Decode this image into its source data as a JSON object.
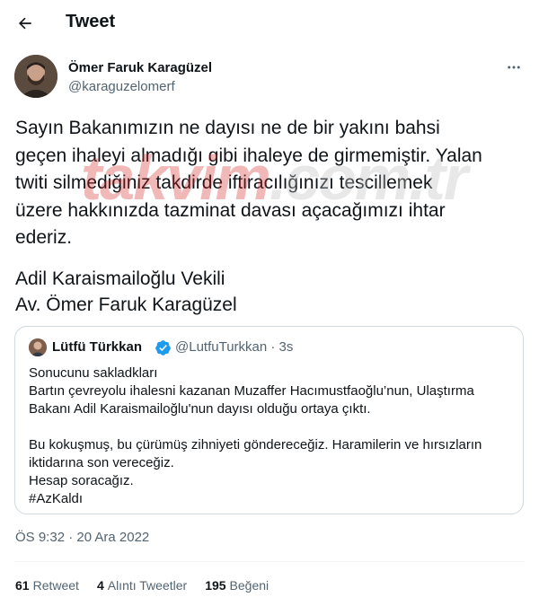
{
  "header": {
    "title": "Tweet"
  },
  "author": {
    "name": "Ömer Faruk Karagüzel",
    "handle": "@karaguzelomerf"
  },
  "tweet": {
    "text": "Sayın Bakanımızın ne dayısı ne de bir yakını bahsi\ngeçen ihaleyi almadığı gibi ihaleye de girmemiştir. Yalan\ntwiti silmediğiniz takdirde iftiracılığınızı tescillemek\nüzere hakkınızda tazminat davası açacağımızı ihtar\nederiz.",
    "signature_line1": "Adil Karaismailoğlu Vekili",
    "signature_line2": "Av. Ömer Faruk Karagüzel"
  },
  "watermark": {
    "main": "takvim",
    "tld": ".com.tr"
  },
  "quote": {
    "name": "Lütfü Türkkan",
    "handle_time": "@LutfuTurkkan · 3s",
    "lines": [
      "Sonucunu sakladkları",
      "Bartın çevreyolu ihalesni kazanan Muzaffer Hacımustfaoğlu’nun, Ulaştırma",
      "Bakanı Adil Karaismailoğlu'nun dayısı olduğu ortaya çıktı.",
      "",
      "Bu kokuşmuş, bu çürümüş zihniyeti göndereceğiz. Haramilerin ve hırsızların",
      "iktidarına son vereceğiz.",
      "Hesap soracağız.",
      "#AzKaldı"
    ]
  },
  "timestamp": "ÖS 9:32 · 20 Ara 2022",
  "stats": {
    "retweets_count": "61",
    "retweets_label": "Retweet",
    "quotes_count": "4",
    "quotes_label": "Alıntı Tweetler",
    "likes_count": "195",
    "likes_label": "Beğeni"
  },
  "colors": {
    "text": "#0f1419",
    "secondary": "#536471",
    "border": "#cfd9de",
    "verified": "#1d9bf0",
    "hashtag": "#0f1419"
  },
  "icons": {
    "back": "arrow-left-icon",
    "more": "more-dots-icon",
    "verified": "verified-badge-icon"
  }
}
